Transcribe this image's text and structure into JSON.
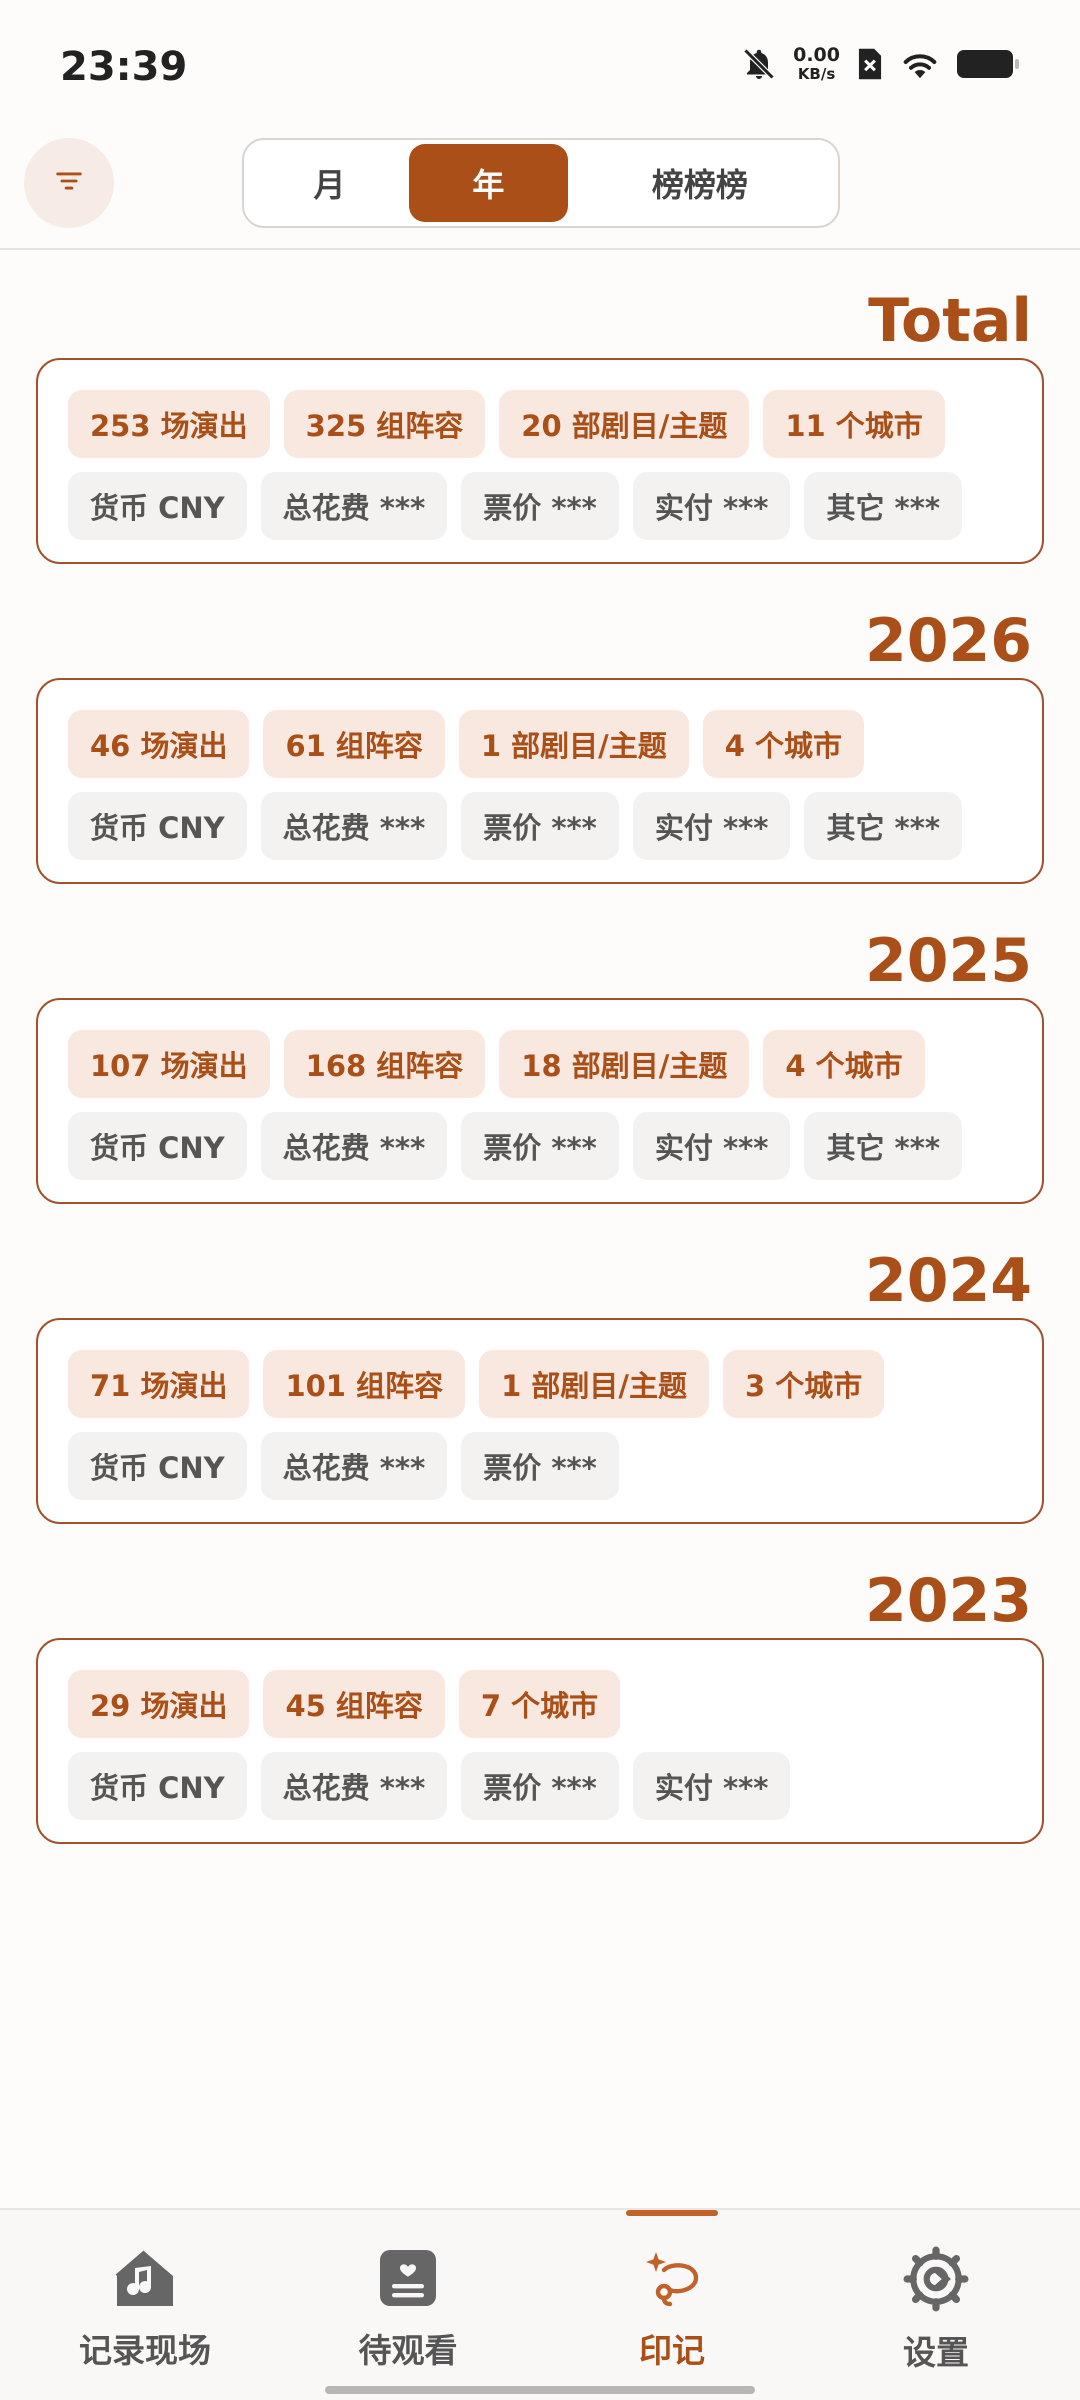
{
  "status_bar": {
    "time": "23:39",
    "net_speed_value": "0.00",
    "net_speed_unit": "KB/s",
    "icons": [
      "bell-off-icon",
      "no-sim-icon",
      "wifi-icon",
      "battery-icon"
    ]
  },
  "header": {
    "filter_icon": "filter-icon",
    "tabs": [
      {
        "label": "月",
        "active": false
      },
      {
        "label": "年",
        "active": true
      },
      {
        "label": "榜榜榜",
        "active": false
      }
    ]
  },
  "sections": [
    {
      "title": "Total",
      "highlights": [
        "253 场演出",
        "325 组阵容",
        "20 部剧目/主题",
        "11 个城市"
      ],
      "stats": [
        "货币 CNY",
        "总花费 ***",
        "票价 ***",
        "实付 ***",
        "其它 ***"
      ]
    },
    {
      "title": "2026",
      "highlights": [
        "46 场演出",
        "61 组阵容",
        "1 部剧目/主题",
        "4 个城市"
      ],
      "stats": [
        "货币 CNY",
        "总花费 ***",
        "票价 ***",
        "实付 ***",
        "其它 ***"
      ]
    },
    {
      "title": "2025",
      "highlights": [
        "107 场演出",
        "168 组阵容",
        "18 部剧目/主题",
        "4 个城市"
      ],
      "stats": [
        "货币 CNY",
        "总花费 ***",
        "票价 ***",
        "实付 ***",
        "其它 ***"
      ]
    },
    {
      "title": "2024",
      "highlights": [
        "71 场演出",
        "101 组阵容",
        "1 部剧目/主题",
        "3 个城市"
      ],
      "stats": [
        "货币 CNY",
        "总花费 ***",
        "票价 ***"
      ]
    },
    {
      "title": "2023",
      "highlights": [
        "29 场演出",
        "45 组阵容",
        "7 个城市"
      ],
      "stats": [
        "货币 CNY",
        "总花费 ***",
        "票价 ***",
        "实付 ***"
      ]
    }
  ],
  "bottom_nav": {
    "items": [
      {
        "label": "记录现场",
        "icon": "home-music-icon",
        "active": false
      },
      {
        "label": "待观看",
        "icon": "list-card-icon",
        "active": false
      },
      {
        "label": "印记",
        "icon": "sparkle-lasso-icon",
        "active": true
      },
      {
        "label": "设置",
        "icon": "gear-icon",
        "active": false
      }
    ]
  },
  "colors": {
    "accent": "#a94f17",
    "chip_highlight_bg": "#f8e8df",
    "chip_neutral_bg": "#f3f2f1",
    "card_border": "#a0522d"
  }
}
